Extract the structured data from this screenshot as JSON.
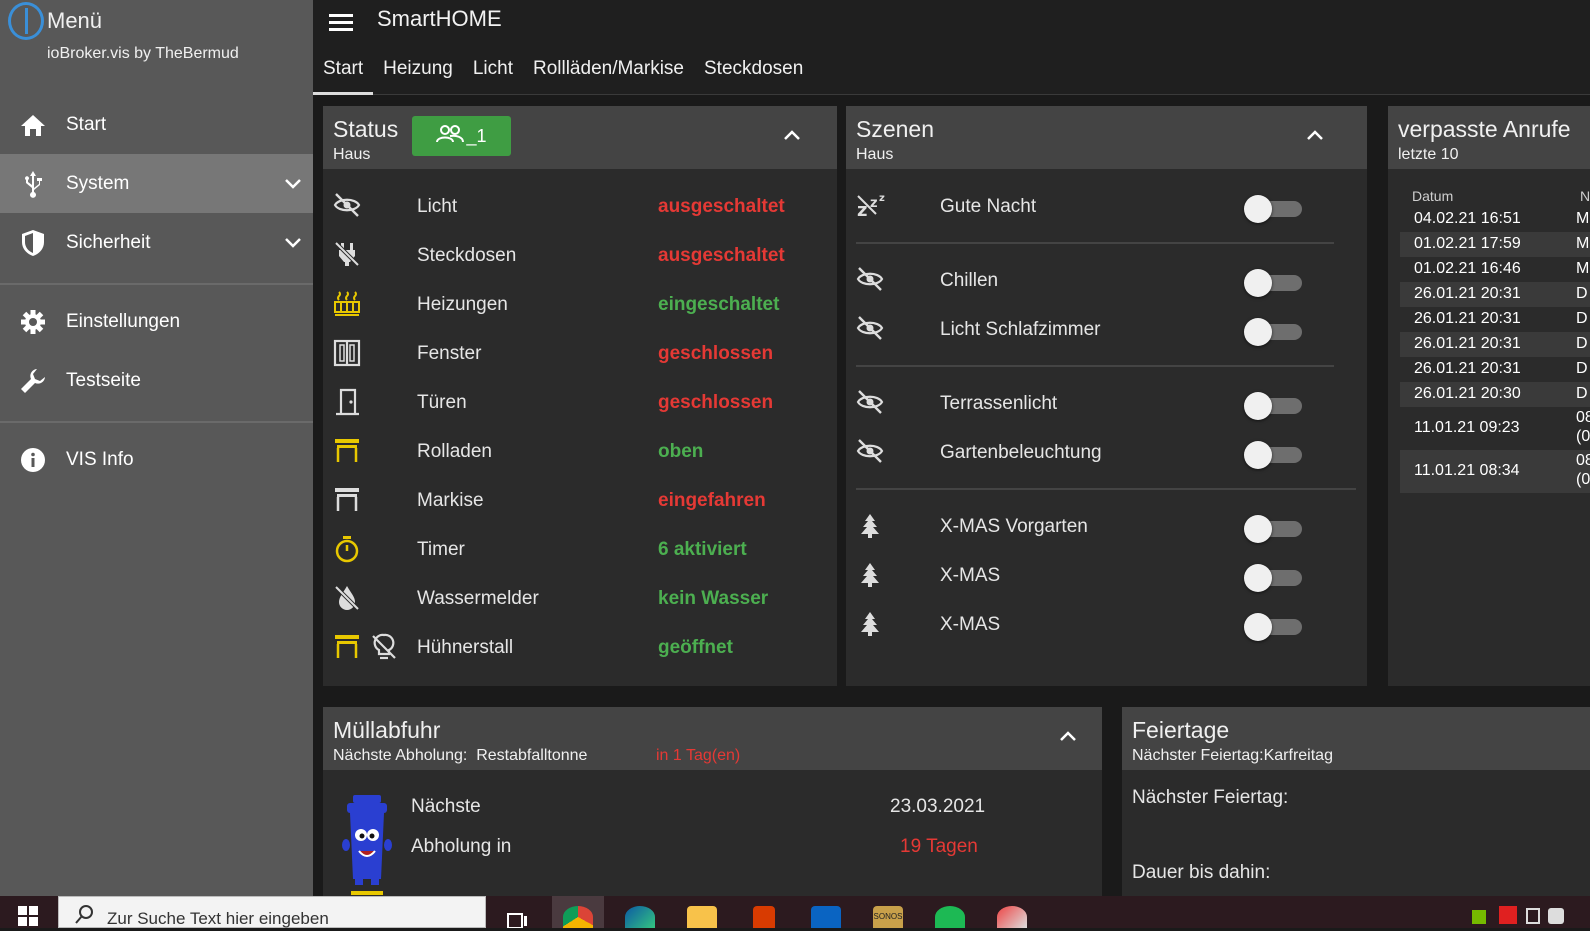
{
  "sidebar": {
    "title": "Menü",
    "subtitle": "ioBroker.vis by TheBermud",
    "items": [
      {
        "label": "Start",
        "icon": "home-icon"
      },
      {
        "label": "System",
        "icon": "usb-icon",
        "expandable": true,
        "active": true
      },
      {
        "label": "Sicherheit",
        "icon": "shield-icon",
        "expandable": true
      },
      {
        "label": "Einstellungen",
        "icon": "gear-icon"
      },
      {
        "label": "Testseite",
        "icon": "wrench-icon"
      },
      {
        "label": "VIS Info",
        "icon": "info-icon"
      }
    ]
  },
  "header": {
    "title": "SmartHOME",
    "tabs": [
      "Start",
      "Heizung",
      "Licht",
      "Rollläden/Markise",
      "Steckdosen"
    ],
    "active_tab": "Start"
  },
  "status_card": {
    "title": "Status",
    "subtitle": "Haus",
    "badge": "_1",
    "rows": [
      {
        "label": "Licht",
        "value": "ausgeschaltet",
        "state": "red",
        "icon": "light-off-icon"
      },
      {
        "label": "Steckdosen",
        "value": "ausgeschaltet",
        "state": "red",
        "icon": "plug-off-icon"
      },
      {
        "label": "Heizungen",
        "value": "eingeschaltet",
        "state": "green",
        "icon": "radiator-icon"
      },
      {
        "label": "Fenster",
        "value": "geschlossen",
        "state": "red",
        "icon": "window-icon"
      },
      {
        "label": "Türen",
        "value": "geschlossen",
        "state": "red",
        "icon": "door-icon"
      },
      {
        "label": "Rolladen",
        "value": "oben",
        "state": "green",
        "icon": "shutter-icon"
      },
      {
        "label": "Markise",
        "value": "eingefahren",
        "state": "red",
        "icon": "awning-icon"
      },
      {
        "label": "Timer",
        "value": "6 aktiviert",
        "state": "green",
        "icon": "timer-icon"
      },
      {
        "label": "Wassermelder",
        "value": "kein Wasser",
        "state": "green",
        "icon": "water-off-icon"
      },
      {
        "label": "Hühnerstall",
        "value": "geöffnet",
        "state": "green",
        "icon": "coop-icon"
      }
    ]
  },
  "scenes_card": {
    "title": "Szenen",
    "subtitle": "Haus",
    "rows": [
      {
        "label": "Gute Nacht",
        "icon": "sleep-icon",
        "on": false
      },
      {
        "label": "Chillen",
        "icon": "light-off-icon",
        "on": false
      },
      {
        "label": "Licht Schlafzimmer",
        "icon": "light-off-icon",
        "on": false
      },
      {
        "label": "Terrassenlicht",
        "icon": "light-off-icon",
        "on": false
      },
      {
        "label": "Gartenbeleuchtung",
        "icon": "light-off-icon",
        "on": false
      },
      {
        "label": "X-MAS Vorgarten",
        "icon": "tree-icon",
        "on": false
      },
      {
        "label": "X-MAS",
        "icon": "tree-icon",
        "on": false
      },
      {
        "label": "X-MAS",
        "icon": "tree-icon",
        "on": false
      }
    ]
  },
  "calls_card": {
    "title": "verpasste Anrufe",
    "subtitle": "letzte 10",
    "col_date": "Datum",
    "col_name": "N",
    "rows": [
      {
        "date": "04.02.21 16:51",
        "name": "M"
      },
      {
        "date": "01.02.21 17:59",
        "name": "M"
      },
      {
        "date": "01.02.21 16:46",
        "name": "M"
      },
      {
        "date": "26.01.21 20:31",
        "name": "D"
      },
      {
        "date": "26.01.21 20:31",
        "name": "D"
      },
      {
        "date": "26.01.21 20:31",
        "name": "D"
      },
      {
        "date": "26.01.21 20:31",
        "name": "D"
      },
      {
        "date": "26.01.21 20:30",
        "name": "D"
      },
      {
        "date": "11.01.21 09:23",
        "name": "08",
        "name2": "(0"
      },
      {
        "date": "11.01.21 08:34",
        "name": "08",
        "name2": "(0"
      }
    ]
  },
  "waste_card": {
    "title": "Müllabfuhr",
    "subtitle_prefix": "Nächste Abholung:",
    "subtitle_type": "Restabfalltonne",
    "subtitle_due": "in 1 Tag(en)",
    "next_label": "Nächste",
    "next_value": "23.03.2021",
    "in_label": "Abholung in",
    "in_value": "19 Tagen"
  },
  "holiday_card": {
    "title": "Feiertage",
    "subtitle": "Nächster Feiertag:Karfreitag",
    "next_label": "Nächster Feiertag:",
    "duration_label": "Dauer bis dahin:"
  },
  "taskbar": {
    "search_placeholder": "Zur Suche Text hier eingeben",
    "apps": [
      "task-view-icon",
      "chrome-icon",
      "edge-icon",
      "explorer-icon",
      "office-icon",
      "outlook-icon",
      "sonos-icon",
      "spotify-icon",
      "app-icon"
    ],
    "sonos_label": "SONOS"
  },
  "colors": {
    "on": "#4caf50",
    "off": "#e53935",
    "accent_badge": "#3f9d43",
    "logo": "#3a8fd8"
  }
}
